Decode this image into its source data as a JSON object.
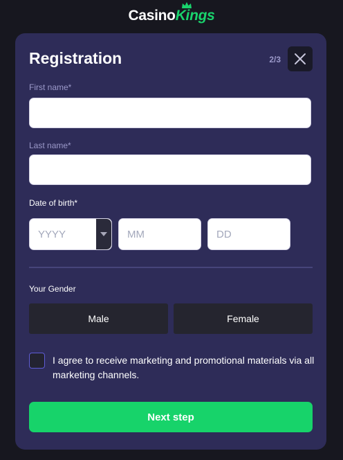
{
  "brand": {
    "part1": "Casino",
    "part2": "Kings",
    "accent_color": "#19d36c"
  },
  "modal": {
    "title": "Registration",
    "step": "2/3",
    "close_icon": "close-icon"
  },
  "form": {
    "first_name_label": "First name*",
    "first_name_value": "",
    "last_name_label": "Last name*",
    "last_name_value": "",
    "dob_label": "Date of birth*",
    "year_placeholder": "YYYY",
    "month_placeholder": "MM",
    "day_placeholder": "DD",
    "gender_label": "Your Gender",
    "gender_options": [
      "Male",
      "Female"
    ],
    "consent_text": "I agree to receive marketing and promotional materials via all marketing channels.",
    "consent_checked": false,
    "submit_label": "Next step"
  },
  "colors": {
    "background": "#17171f",
    "card": "#2e2c58",
    "primary_button": "#17d36a",
    "muted_label": "#9b99c9"
  }
}
